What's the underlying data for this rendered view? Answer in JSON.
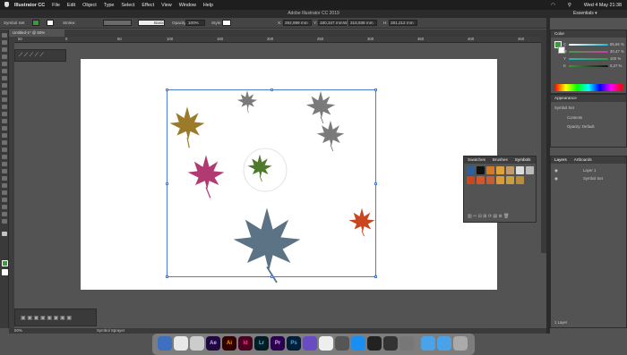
{
  "menubar": {
    "app": "Illustrator CC",
    "items": [
      "File",
      "Edit",
      "Object",
      "Type",
      "Select",
      "Effect",
      "View",
      "Window",
      "Help"
    ],
    "clock": "Wed 4 May  21:38"
  },
  "window": {
    "title": "Adobe Illustrator CC 2019",
    "workspace": "Essentials"
  },
  "control_bar": {
    "selection": "Symbol Set",
    "stroke_label": "Stroke:",
    "brush": "Basic",
    "opacity_label": "Opacity:",
    "opacity_value": "100%",
    "style_label": "Style:",
    "x_label": "X:",
    "x_value": "292,999 mm",
    "y_label": "Y:",
    "y_value": "180,347 mm",
    "w_label": "W:",
    "w_value": "318,938 mm",
    "h_label": "H:",
    "h_value": "281,212 mm"
  },
  "document_tab": {
    "label": "Untitled-1* @ 50% (CMYK/GPU Preview)"
  },
  "ruler": {
    "ticks": [
      "50",
      "0",
      "50",
      "100",
      "150",
      "200",
      "250",
      "300",
      "350",
      "400",
      "450"
    ]
  },
  "status_bar": {
    "zoom": "50%",
    "tool": "Symbol Sprayer"
  },
  "color_panel": {
    "title": "Color",
    "channels": [
      {
        "label": "C",
        "value": "65,66 %",
        "color": "#28b3c8",
        "level": 0.66
      },
      {
        "label": "M",
        "value": "30,47 %",
        "color": "#c83ca8",
        "level": 0.3
      },
      {
        "label": "Y",
        "value": "100 %",
        "color": "#e0d83a",
        "level": 1.0
      },
      {
        "label": "K",
        "value": "0,27 %",
        "color": "#888888",
        "level": 0.01
      }
    ]
  },
  "appearance_panel": {
    "title": "Appearance",
    "object": "Symbol Set",
    "contents": "Contents",
    "opacity": "Opacity: Default"
  },
  "symbols_panel": {
    "tabs": [
      "Swatches",
      "Brushes",
      "Symbols"
    ]
  },
  "layers_panel": {
    "tabs": [
      "Layers",
      "Artboards"
    ],
    "layer": "Layer 1",
    "sublayer": "Symbol Set",
    "footer": "1 Layer"
  },
  "dock": {
    "apps": [
      {
        "label": "Ae",
        "color": "#1f0740"
      },
      {
        "label": "Ai",
        "color": "#300"
      },
      {
        "label": "Id",
        "color": "#49021f"
      },
      {
        "label": "Lr",
        "color": "#001d26"
      },
      {
        "label": "Pr",
        "color": "#2a004f"
      },
      {
        "label": "Ps",
        "color": "#001e36"
      }
    ]
  },
  "canvas": {
    "leaves": [
      {
        "name": "leaf-brown",
        "color": "#9b7a2a"
      },
      {
        "name": "leaf-gray-1",
        "color": "#7a7a7a"
      },
      {
        "name": "leaf-gray-2",
        "color": "#7a7a7a"
      },
      {
        "name": "leaf-gray-3",
        "color": "#7a7a7a"
      },
      {
        "name": "leaf-magenta",
        "color": "#b23a72"
      },
      {
        "name": "leaf-green",
        "color": "#4f7a2c"
      },
      {
        "name": "leaf-orange",
        "color": "#c9461f"
      },
      {
        "name": "leaf-blue",
        "color": "#5b7384"
      }
    ]
  }
}
